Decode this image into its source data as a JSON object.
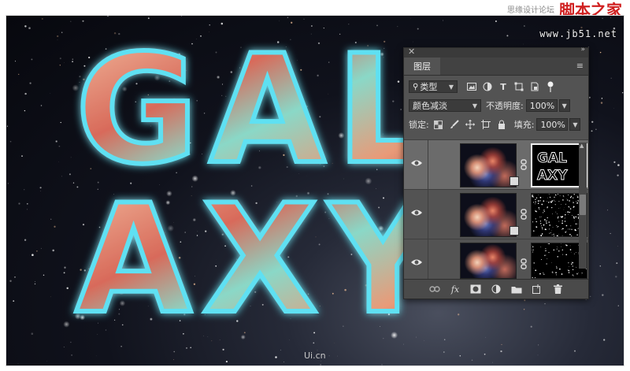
{
  "watermark": {
    "site_small": "思缘设计论坛",
    "brand": "脚本之家",
    "url": "www.jb51.net",
    "bottom": "Ui.cn"
  },
  "artwork": {
    "line1": "GAL",
    "line2": "AXY",
    "colors": {
      "space": "#07080e",
      "glow": "#39c6e0",
      "fill_warm": "#e8926d",
      "fill_teal": "#7fd9c8"
    }
  },
  "panel": {
    "tab_title": "图层",
    "close_glyph": "✕",
    "collapse_glyph": "»",
    "menu_glyph": "≡",
    "filter": {
      "label": "类型",
      "icon": "search-icon"
    },
    "blend_mode": "颜色减淡",
    "opacity_label": "不透明度:",
    "opacity_value": "100%",
    "lock_label": "锁定:",
    "fill_label": "填充:",
    "fill_value": "100%",
    "mask_text_line1": "GAL",
    "mask_text_line2": "AXY",
    "layers": [
      {
        "visible": true,
        "selected": true,
        "thumb": "nebula",
        "mask": "galaxy-text-mask"
      },
      {
        "visible": true,
        "selected": false,
        "thumb": "nebula",
        "mask": "particle-mask"
      },
      {
        "visible": true,
        "selected": false,
        "thumb": "nebula",
        "mask": "star-mask"
      }
    ],
    "bottom_icons": [
      "link-layers-icon",
      "fx-icon",
      "add-mask-icon",
      "adjustment-icon",
      "folder-icon",
      "new-layer-icon",
      "trash-icon"
    ],
    "fx_label": "fx"
  }
}
